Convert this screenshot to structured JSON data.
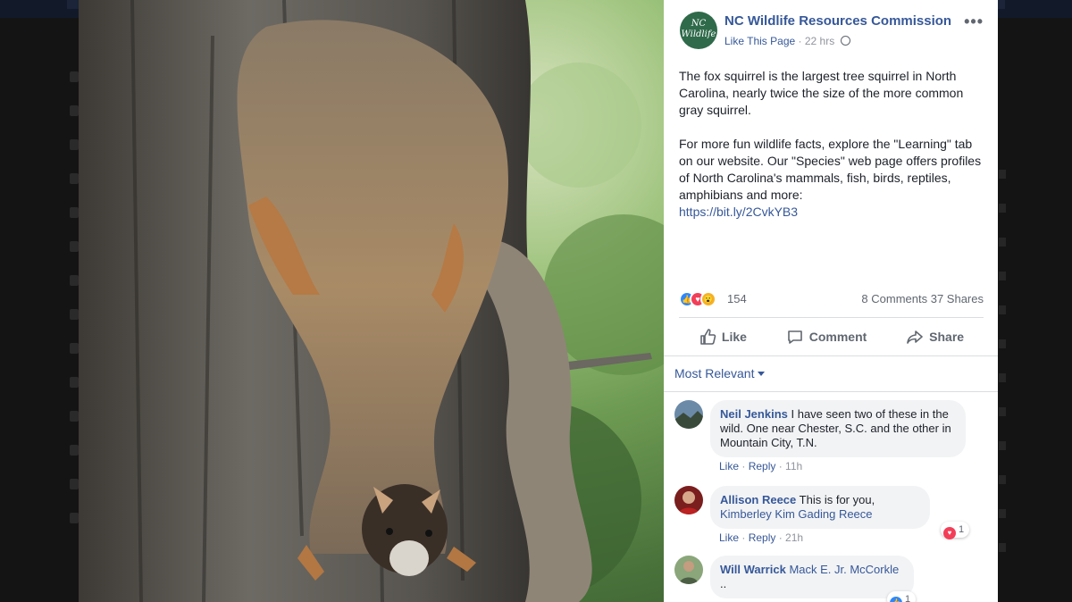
{
  "post": {
    "page_name": "NC Wildlife Resources Commission",
    "avatar_text": "NC Wildlife",
    "like_page": "Like This Page",
    "time": "22 hrs",
    "more": "•••",
    "paragraph1": "The fox squirrel is the largest tree squirrel in North Carolina, nearly twice the size of the more common gray squirrel.",
    "paragraph2": "For more fun wildlife facts, explore the \"Learning\" tab on our website. Our \"Species\" web page offers profiles of North Carolina's mammals, fish, birds, reptiles, amphibians and more:",
    "link": "https://bit.ly/2CvkYB3"
  },
  "stats": {
    "reaction_count": "154",
    "comments": "8 Comments",
    "shares": "37 Shares",
    "reaction_icons": [
      "like-icon",
      "love-icon",
      "wow-icon"
    ]
  },
  "actions": {
    "like": "Like",
    "comment": "Comment",
    "share": "Share"
  },
  "sort": {
    "label": "Most Relevant"
  },
  "comments": [
    {
      "name": "Neil Jenkins",
      "text": "I have seen two of these in the wild. One near Chester, S.C. and the other in Mountain City, T.N.",
      "like": "Like",
      "reply": "Reply",
      "time": "11h"
    },
    {
      "name": "Allison Reece",
      "text": "This is for you,",
      "mention": "Kimberley Kim Gading Reece",
      "like": "Like",
      "reply": "Reply",
      "time": "21h",
      "reaction_count": "1",
      "reaction_icon": "love-icon"
    },
    {
      "name": "Will Warrick",
      "mention": "Mack E. Jr. McCorkle",
      "text": "..",
      "reaction_count": "1",
      "reaction_icon": "like-icon"
    }
  ],
  "colors": {
    "link_blue": "#365899",
    "like_blue": "#2d88ff",
    "love_red": "#f33e58",
    "wow_yellow": "#f7b125",
    "muted": "#90949c"
  }
}
